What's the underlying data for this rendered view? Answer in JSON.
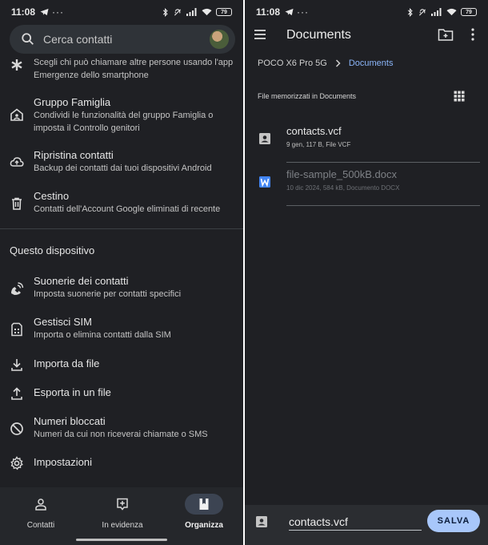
{
  "left": {
    "status": {
      "time": "11:08",
      "battery": "79"
    },
    "search": {
      "placeholder": "Cerca contatti"
    },
    "emergency": {
      "sub": "Scegli chi può chiamare altre persone usando l'app Emergenze dello smartphone"
    },
    "items": [
      {
        "title": "Gruppo Famiglia",
        "sub": "Condividi le funzionalità del gruppo Famiglia o imposta il Controllo genitori"
      },
      {
        "title": "Ripristina contatti",
        "sub": "Backup dei contatti dai tuoi dispositivi Android"
      },
      {
        "title": "Cestino",
        "sub": "Contatti dell'Account Google eliminati di recente"
      }
    ],
    "section": "Questo dispositivo",
    "device_items": [
      {
        "title": "Suonerie dei contatti",
        "sub": "Imposta suonerie per contatti specifici"
      },
      {
        "title": "Gestisci SIM",
        "sub": "Importa o elimina contatti dalla SIM"
      },
      {
        "title": "Importa da file",
        "sub": ""
      },
      {
        "title": "Esporta in un file",
        "sub": ""
      },
      {
        "title": "Numeri bloccati",
        "sub": "Numeri da cui non riceverai chiamate o SMS"
      },
      {
        "title": "Impostazioni",
        "sub": ""
      }
    ],
    "nav": {
      "contacts": "Contatti",
      "highlights": "In evidenza",
      "organize": "Organizza"
    }
  },
  "right": {
    "status": {
      "time": "11:08",
      "battery": "79"
    },
    "title": "Documents",
    "breadcrumb": {
      "device": "POCO X6 Pro 5G",
      "folder": "Documents"
    },
    "saved_header": "File memorizzati in Documents",
    "files": [
      {
        "name": "contacts.vcf",
        "meta": "9 gen, 117 B, File VCF"
      },
      {
        "name": "file-sample_500kB.docx",
        "meta": "10 dic 2024, 584 kB, Documento DOCX"
      }
    ],
    "save": {
      "filename": "contacts.vcf",
      "button": "SALVA"
    }
  },
  "colors": {
    "background": "#1f2024",
    "accent": "#8ab4f8",
    "save_button": "#a8c7fa",
    "word_icon": "#4285f4"
  }
}
